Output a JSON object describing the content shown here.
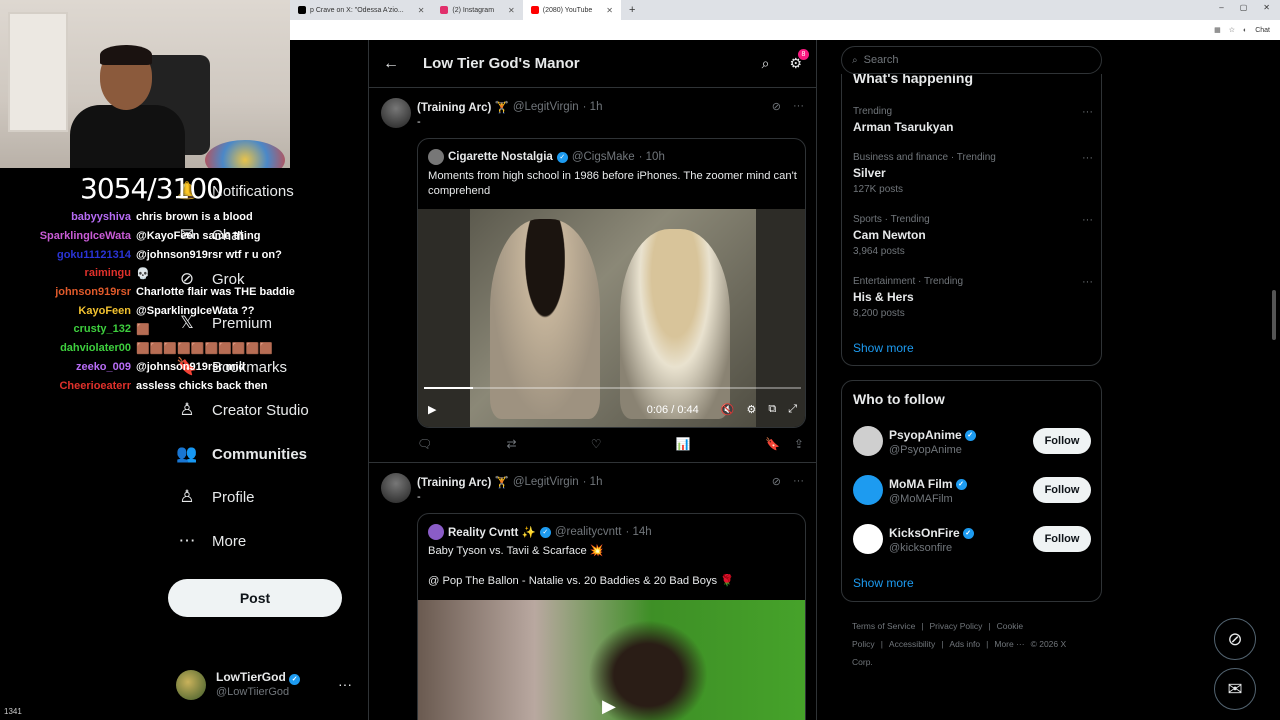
{
  "browser": {
    "tabs": [
      {
        "label": "p Crave on X: \"Odessa A'zio...",
        "icon_color": "#000000",
        "active": false
      },
      {
        "label": "(2) Instagram",
        "icon_color": "#e1306c",
        "active": false
      },
      {
        "label": "(2080) YouTube",
        "icon_color": "#ff0000",
        "active": true
      }
    ],
    "new_tab": "+",
    "chat_label": "Chat",
    "window_controls": [
      "–",
      "▢",
      "✕"
    ]
  },
  "stream": {
    "viewer_count": "3054/3100",
    "frame_counter": "1341",
    "chat": [
      {
        "user": "babyyshiva",
        "color": "#b76cf5",
        "msg": "chris brown is a blood"
      },
      {
        "user": "SparklingIceWata",
        "color": "#c95cd6",
        "msg": "@KayoFeen same thing"
      },
      {
        "user": "goku11121314",
        "color": "#2a34d6",
        "msg": "@johnson919rsr wtf r u on?"
      },
      {
        "user": "raimingu",
        "color": "#e0312b",
        "msg": "💀"
      },
      {
        "user": "johnson919rsr",
        "color": "#e05a2b",
        "msg": "Charlotte flair was THE baddie"
      },
      {
        "user": "KayoFeen",
        "color": "#f2c230",
        "msg": "@SparklingIceWata ??"
      },
      {
        "user": "crusty_132",
        "color": "#3ecf3e",
        "msg": "🟫"
      },
      {
        "user": "dahviolater00",
        "color": "#3ecf3e",
        "msg": "🟫🟫🟫🟫🟫🟫🟫🟫🟫🟫"
      },
      {
        "user": "zeeko_009",
        "color": "#b76cf5",
        "msg": "@johnson919rsr mid"
      },
      {
        "user": "Cheerioeaterr",
        "color": "#e0312b",
        "msg": "assless chicks back then"
      }
    ]
  },
  "nav": {
    "items": [
      {
        "label": "Notifications",
        "icon": "bell-icon",
        "glyph": "🔔",
        "bold": false
      },
      {
        "label": "Chat",
        "icon": "chat-icon",
        "glyph": "✉",
        "bold": false
      },
      {
        "label": "Grok",
        "icon": "grok-icon",
        "glyph": "⊘",
        "bold": false
      },
      {
        "label": "Premium",
        "icon": "x-icon",
        "glyph": "𝕏",
        "bold": false
      },
      {
        "label": "Bookmarks",
        "icon": "bookmark-icon",
        "glyph": "🔖",
        "bold": false
      },
      {
        "label": "Creator Studio",
        "icon": "creator-icon",
        "glyph": "♙",
        "bold": false
      },
      {
        "label": "Communities",
        "icon": "communities-icon",
        "glyph": "👥",
        "bold": true
      },
      {
        "label": "Profile",
        "icon": "profile-icon",
        "glyph": "♙",
        "bold": false
      },
      {
        "label": "More",
        "icon": "more-icon",
        "glyph": "⋯",
        "bold": false
      }
    ],
    "post_label": "Post"
  },
  "account": {
    "name": "LowTierGod",
    "handle": "@LowTiierGod",
    "more": "···"
  },
  "main": {
    "title": "Low Tier God's Manor",
    "notif_badge": "8",
    "tweets": [
      {
        "name": "(Training Arc) 🏋",
        "handle": "@LegitVirgin",
        "time": "· 1h",
        "body": "-",
        "quote": {
          "name": "Cigarette Nostalgia",
          "handle": "@CigsMake",
          "time": "· 10h",
          "text": "Moments from high school in 1986 before iPhones. The zoomer mind can't comprehend"
        },
        "video": {
          "time": "0:06 / 0:44",
          "progress": 0.13
        }
      },
      {
        "name": "(Training Arc) 🏋",
        "handle": "@LegitVirgin",
        "time": "· 1h",
        "body": "-",
        "quote": {
          "name": "Reality Cvntt ✨",
          "handle": "@realitycvntt",
          "time": "· 14h",
          "text": "Baby Tyson vs. Tavii & Scarface 💥",
          "text2": "@ Pop The Ballon - Natalie vs. 20 Baddies & 20 Bad Boys 🌹"
        }
      }
    ]
  },
  "sidebar": {
    "search_placeholder": "Search",
    "happening_title": "What's happening",
    "trends": [
      {
        "category": "Trending",
        "name": "Arman Tsarukyan",
        "count": ""
      },
      {
        "category": "Business and finance · Trending",
        "name": "Silver",
        "count": "127K posts"
      },
      {
        "category": "Sports · Trending",
        "name": "Cam Newton",
        "count": "3,964 posts"
      },
      {
        "category": "Entertainment · Trending",
        "name": "His & Hers",
        "count": "8,200 posts"
      }
    ],
    "show_more": "Show more",
    "wtf_title": "Who to follow",
    "who_to_follow": [
      {
        "name": "PsyopAnime",
        "handle": "@PsyopAnime",
        "avatar_color": "#cfcfcf"
      },
      {
        "name": "MoMA Film",
        "handle": "@MoMAFilm",
        "avatar_color": "#1d9bf0"
      },
      {
        "name": "KicksOnFire",
        "handle": "@kicksonfire",
        "avatar_color": "#ffffff"
      }
    ],
    "follow_label": "Follow",
    "footer": [
      "Terms of Service",
      "|",
      "Privacy Policy",
      "|",
      "Cookie Policy",
      "|",
      "Accessibility",
      "|",
      "Ads info",
      "|",
      "More ···",
      "© 2026 X Corp."
    ]
  }
}
